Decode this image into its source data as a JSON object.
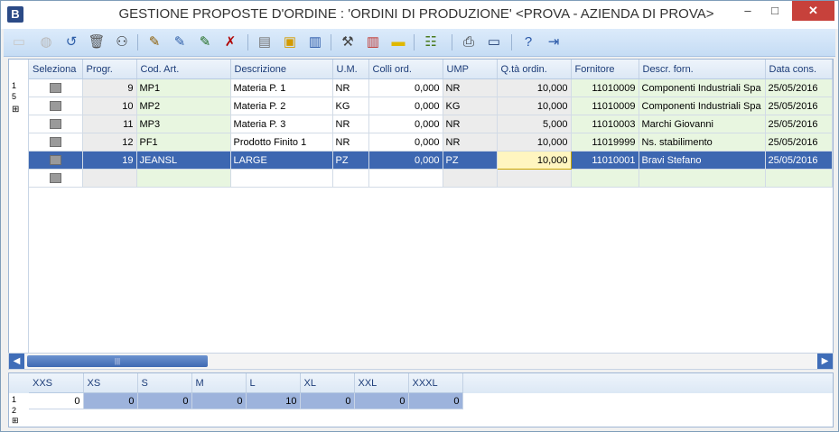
{
  "window": {
    "app_badge": "B",
    "title": "GESTIONE PROPOSTE D'ORDINE :  'ORDINI DI PRODUZIONE' <PROVA - AZIENDA DI PROVA>",
    "min_glyph": "–",
    "max_glyph": "□",
    "close_glyph": "✕"
  },
  "toolbar": {
    "icons": [
      {
        "name": "new-document-icon",
        "glyph": "▭",
        "color": "#c8c8c8"
      },
      {
        "name": "save-icon",
        "glyph": "◍",
        "color": "#b9b9b9"
      },
      {
        "name": "undo-icon",
        "glyph": "↺",
        "color": "#2f5fa8"
      },
      {
        "name": "delete-icon",
        "glyph": "🗑",
        "color": "#555555"
      },
      {
        "name": "find-icon",
        "glyph": "⚇",
        "color": "#333333"
      },
      {
        "name": "edit-row-icon",
        "glyph": "✎",
        "color": "#8a5a00"
      },
      {
        "name": "insert-row-icon",
        "glyph": "✎",
        "color": "#2f5fa8"
      },
      {
        "name": "restore-row-icon",
        "glyph": "✎",
        "color": "#1f6b1f"
      },
      {
        "name": "delete-row-icon",
        "glyph": "✗",
        "color": "#b00000"
      },
      {
        "name": "page-icon",
        "glyph": "▤",
        "color": "#777777"
      },
      {
        "name": "documents-icon",
        "glyph": "▣",
        "color": "#d39a00"
      },
      {
        "name": "book-icon",
        "glyph": "▥",
        "color": "#2a58a8"
      },
      {
        "name": "tools-icon",
        "glyph": "⚒",
        "color": "#444444"
      },
      {
        "name": "red-book-icon",
        "glyph": "▥",
        "color": "#c0322b"
      },
      {
        "name": "ruler-icon",
        "glyph": "▬",
        "color": "#e0b800"
      },
      {
        "name": "layout-dropdown-icon",
        "glyph": "☷",
        "color": "#4a7a1e"
      },
      {
        "name": "print-icon",
        "glyph": "⎙",
        "color": "#333333"
      },
      {
        "name": "monitor-icon",
        "glyph": "▭",
        "color": "#1e3c70"
      },
      {
        "name": "help-icon",
        "glyph": "?",
        "color": "#2a58a8"
      },
      {
        "name": "exit-icon",
        "glyph": "⇥",
        "color": "#2a58a8"
      }
    ]
  },
  "grid": {
    "row_header": [
      "1",
      "5"
    ],
    "columns": [
      "Seleziona",
      "Progr.",
      "Cod. Art.",
      "Descrizione",
      "U.M.",
      "Colli ord.",
      "UMP",
      "Q.tà ordin.",
      "Fornitore",
      "Descr. forn.",
      "Data cons."
    ],
    "rows": [
      {
        "progr": "9",
        "cod": "MP1",
        "desc": "Materia P. 1",
        "um": "NR",
        "colli": "0,000",
        "ump": "NR",
        "qta": "10,000",
        "forn": "11010009",
        "descr_forn": "Componenti Industriali Spa",
        "data": "25/05/2016"
      },
      {
        "progr": "10",
        "cod": "MP2",
        "desc": "Materia P. 2",
        "um": "KG",
        "colli": "0,000",
        "ump": "KG",
        "qta": "10,000",
        "forn": "11010009",
        "descr_forn": "Componenti Industriali Spa",
        "data": "25/05/2016"
      },
      {
        "progr": "11",
        "cod": "MP3",
        "desc": "Materia P. 3",
        "um": "NR",
        "colli": "0,000",
        "ump": "NR",
        "qta": "5,000",
        "forn": "11010003",
        "descr_forn": "Marchi Giovanni",
        "data": "25/05/2016"
      },
      {
        "progr": "12",
        "cod": "PF1",
        "desc": "Prodotto Finito 1",
        "um": "NR",
        "colli": "0,000",
        "ump": "NR",
        "qta": "10,000",
        "forn": "11019999",
        "descr_forn": "Ns. stabilimento",
        "data": "25/05/2016"
      },
      {
        "progr": "19",
        "cod": "JEANSL",
        "desc": "LARGE",
        "um": "PZ",
        "colli": "0,000",
        "ump": "PZ",
        "qta": "10,000",
        "forn": "11010001",
        "descr_forn": "Bravi Stefano",
        "data": "25/05/2016"
      }
    ]
  },
  "scrollbar": {
    "left_glyph": "◀",
    "right_glyph": "▶",
    "thumb_glyph": "|||"
  },
  "sizes": {
    "row_header": [
      "1",
      "2"
    ],
    "columns": [
      "XXS",
      "XS",
      "S",
      "M",
      "L",
      "XL",
      "XXL",
      "XXXL"
    ],
    "values": [
      "0",
      "0",
      "0",
      "0",
      "10",
      "0",
      "0",
      "0"
    ]
  }
}
